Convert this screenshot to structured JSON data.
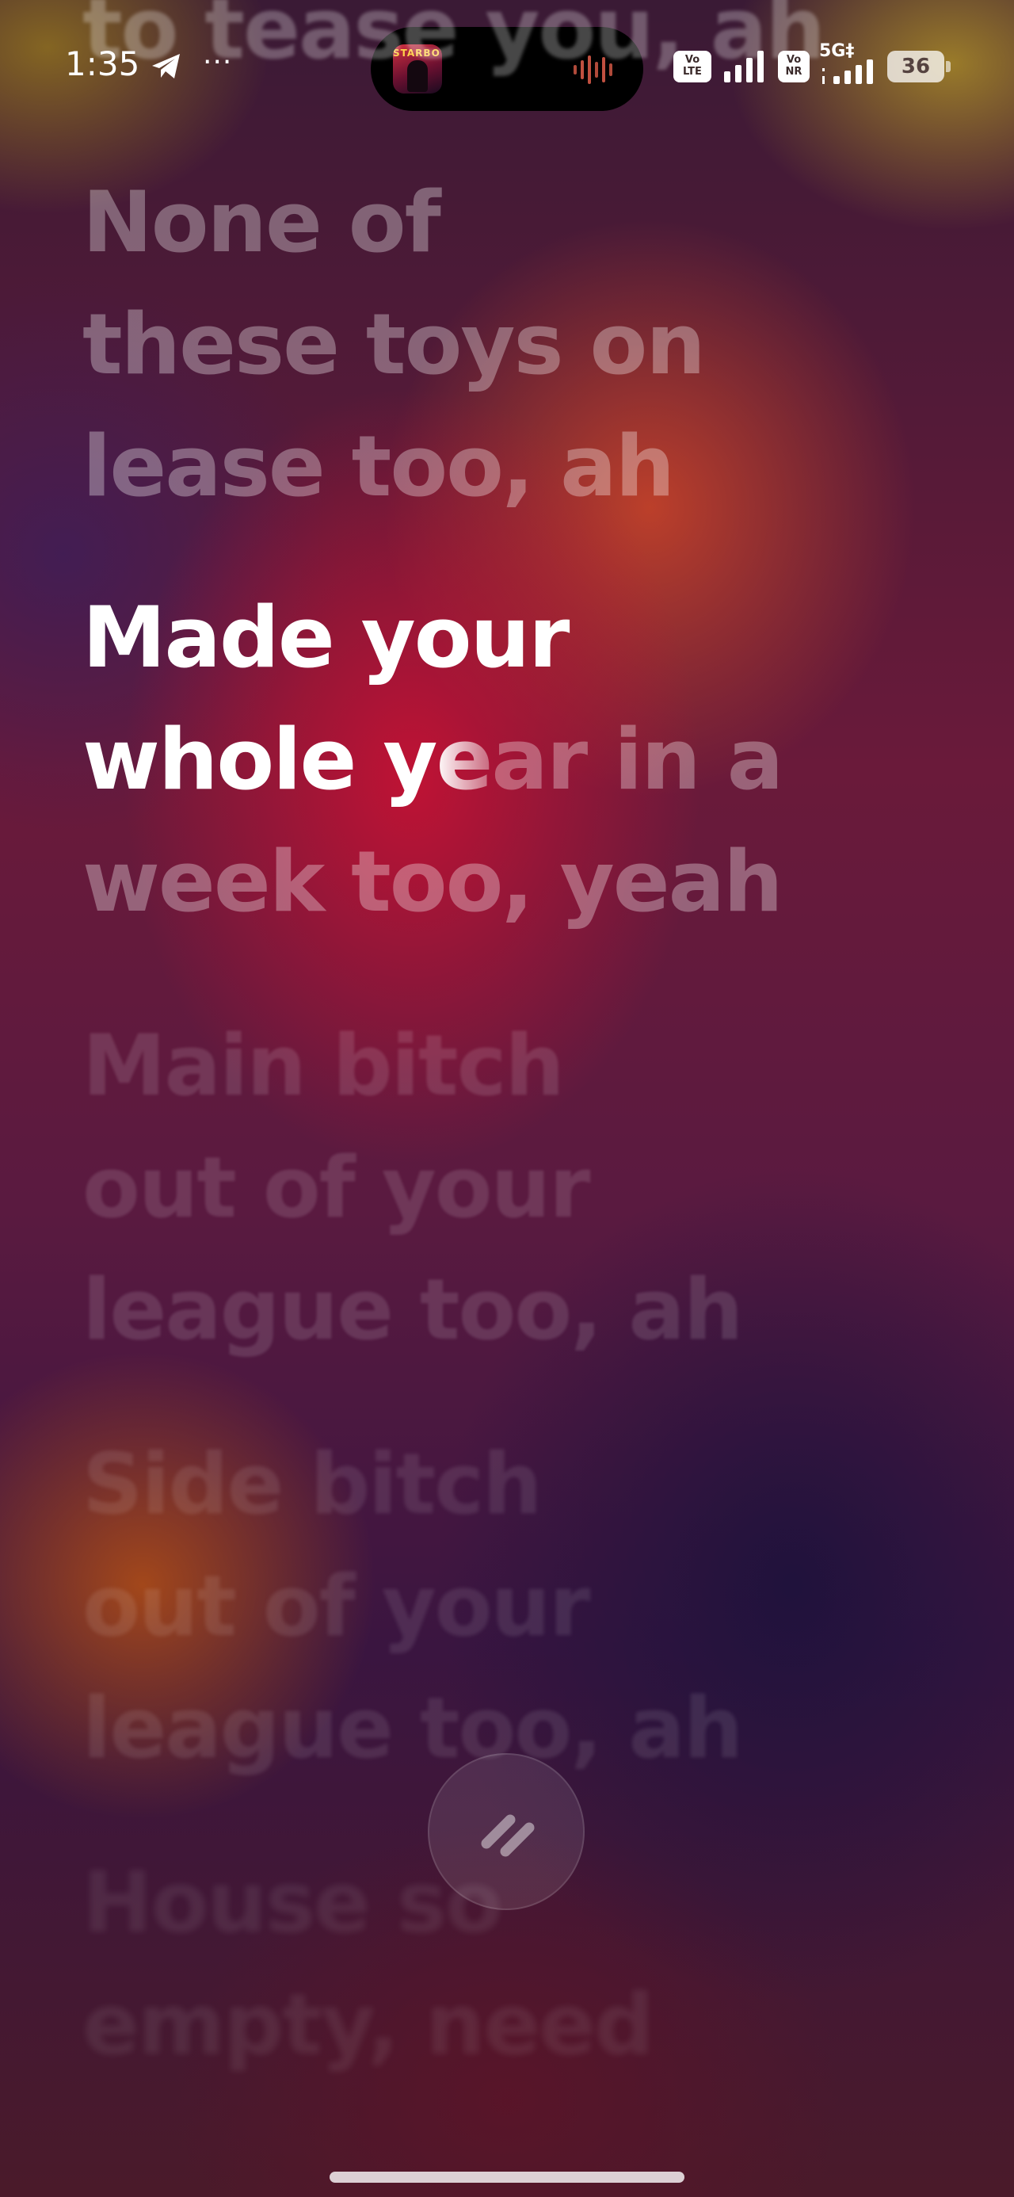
{
  "status_bar": {
    "time": "1:35",
    "more_indicator": "···",
    "icons": [
      "telegram-icon",
      "volte-icon",
      "cellular-signal-icon",
      "vonr-icon",
      "5g-signal-icon",
      "battery-icon"
    ],
    "volte_label": "Vo\nLTE",
    "vonr_label": "Vo\nNR",
    "network_label": "5G‡",
    "battery_level": "36"
  },
  "now_playing": {
    "album_title": "STARBOY"
  },
  "lyrics": {
    "previous_partial": "to tease you, ah",
    "previous": "None of\nthese toys on\nlease too, ah",
    "active": {
      "sung": "Made your\nwhole y",
      "transition": "e",
      "unsung": "ar in a\nweek too, yeah"
    },
    "next_1": "Main bitch\nout of your\nleague too, ah",
    "next_2": "Side bitch\nout of your\nleague too, ah",
    "next_3": "House so\nempty, need"
  },
  "controls": {
    "pause_icon": "pause-icon"
  },
  "colors": {
    "active_lyric": "#ffffff",
    "background_primary": "#c41234",
    "background_secondary": "#1e123c"
  }
}
